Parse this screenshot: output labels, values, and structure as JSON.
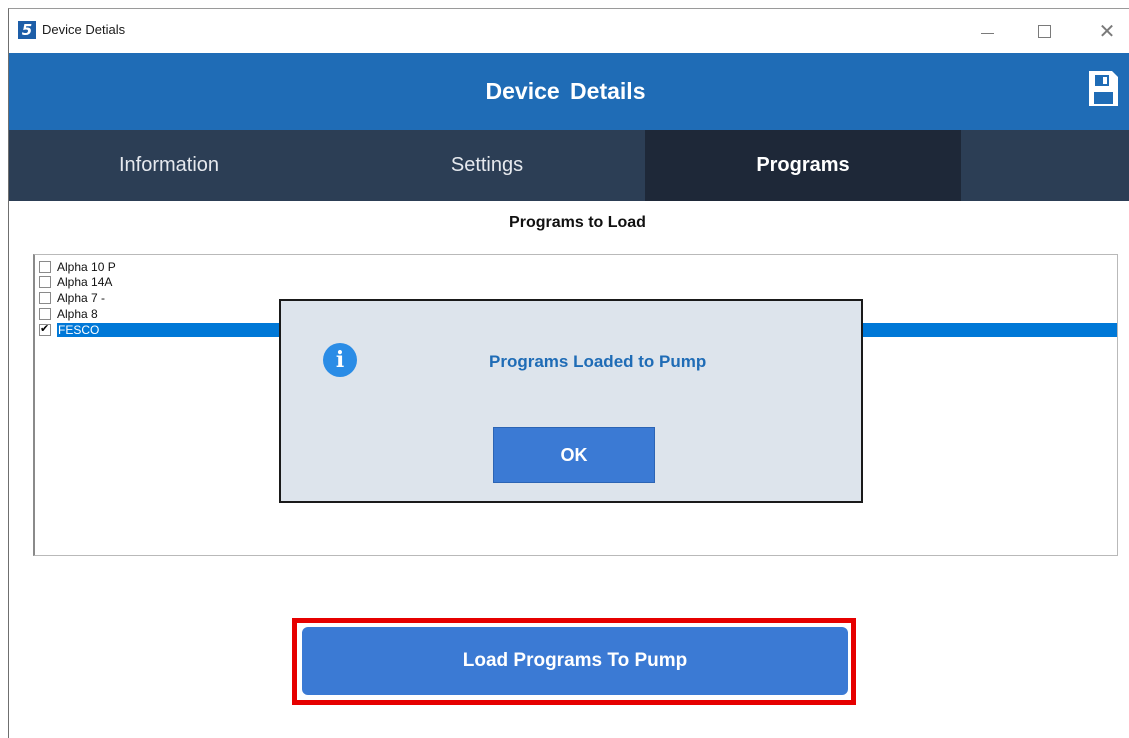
{
  "window": {
    "title": "Device Detials",
    "app_icon_glyph": "5"
  },
  "header": {
    "title": "Device  Details",
    "save_icon": "save-icon"
  },
  "tabs": [
    {
      "label": "Information",
      "active": false
    },
    {
      "label": "Settings",
      "active": false
    },
    {
      "label": "Programs",
      "active": true
    }
  ],
  "programs": {
    "title": "Programs to Load",
    "items": [
      {
        "label": "Alpha 10 P",
        "checked": false,
        "selected": false
      },
      {
        "label": "Alpha 14A",
        "checked": false,
        "selected": false
      },
      {
        "label": "Alpha 7 -",
        "checked": false,
        "selected": false
      },
      {
        "label": "Alpha 8",
        "checked": false,
        "selected": false
      },
      {
        "label": "FESCO",
        "checked": true,
        "selected": true
      }
    ],
    "load_button_label": "Load Programs To Pump"
  },
  "dialog": {
    "message": "Programs Loaded to Pump",
    "ok_label": "OK",
    "icon": "info-icon"
  },
  "colors": {
    "header_blue": "#1f6cb6",
    "tab_bar": "#2c3e55",
    "tab_active": "#1e2838",
    "button_blue": "#3b7ad4",
    "highlight_red": "#e60000",
    "selection_blue": "#0078d7"
  }
}
